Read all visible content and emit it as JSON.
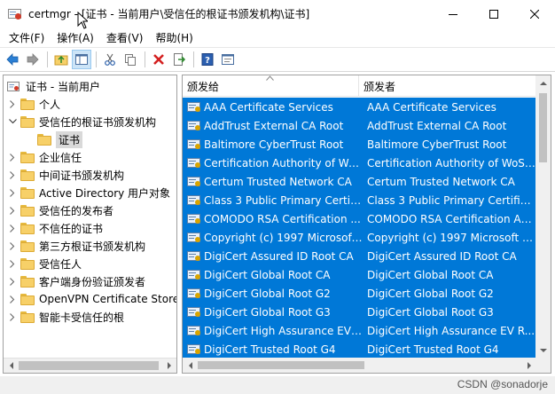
{
  "window": {
    "title": "certmgr - [证书 - 当前用户\\受信任的根证书颁发机构\\证书]"
  },
  "menu": [
    "文件(F)",
    "操作(A)",
    "查看(V)",
    "帮助(H)"
  ],
  "tree": {
    "root": "证书 - 当前用户",
    "items": [
      {
        "label": "个人",
        "level": 1,
        "expanded": false
      },
      {
        "label": "受信任的根证书颁发机构",
        "level": 1,
        "expanded": true
      },
      {
        "label": "证书",
        "level": 2,
        "selected": true
      },
      {
        "label": "企业信任",
        "level": 1,
        "expanded": false
      },
      {
        "label": "中间证书颁发机构",
        "level": 1,
        "expanded": false
      },
      {
        "label": "Active Directory 用户对象",
        "level": 1,
        "expanded": false
      },
      {
        "label": "受信任的发布者",
        "level": 1,
        "expanded": false
      },
      {
        "label": "不信任的证书",
        "level": 1,
        "expanded": false
      },
      {
        "label": "第三方根证书颁发机构",
        "level": 1,
        "expanded": false
      },
      {
        "label": "受信任人",
        "level": 1,
        "expanded": false
      },
      {
        "label": "客户端身份验证颁发者",
        "level": 1,
        "expanded": false
      },
      {
        "label": "OpenVPN Certificate Store",
        "level": 1,
        "expanded": false
      },
      {
        "label": "智能卡受信任的根",
        "level": 1,
        "expanded": false
      }
    ]
  },
  "list": {
    "columns": [
      "颁发给",
      "颁发者"
    ],
    "rows": [
      [
        "AAA Certificate Services",
        "AAA Certificate Services"
      ],
      [
        "AddTrust External CA Root",
        "AddTrust External CA Root"
      ],
      [
        "Baltimore CyberTrust Root",
        "Baltimore CyberTrust Root"
      ],
      [
        "Certification Authority of Wo...",
        "Certification Authority of WoSi..."
      ],
      [
        "Certum Trusted Network CA",
        "Certum Trusted Network CA"
      ],
      [
        "Class 3 Public Primary Certifi...",
        "Class 3 Public Primary Certifica..."
      ],
      [
        "COMODO RSA Certification ...",
        "COMODO RSA Certification Au..."
      ],
      [
        "Copyright (c) 1997 Microsoft...",
        "Copyright (c) 1997 Microsoft C..."
      ],
      [
        "DigiCert Assured ID Root CA",
        "DigiCert Assured ID Root CA"
      ],
      [
        "DigiCert Global Root CA",
        "DigiCert Global Root CA"
      ],
      [
        "DigiCert Global Root G2",
        "DigiCert Global Root G2"
      ],
      [
        "DigiCert Global Root G3",
        "DigiCert Global Root G3"
      ],
      [
        "DigiCert High Assurance EV ...",
        "DigiCert High Assurance EV R..."
      ],
      [
        "DigiCert Trusted Root G4",
        "DigiCert Trusted Root G4"
      ]
    ]
  },
  "watermark": "CSDN @sonadorje",
  "colors": {
    "selection": "#0078d7",
    "folder": "#f7d068"
  }
}
